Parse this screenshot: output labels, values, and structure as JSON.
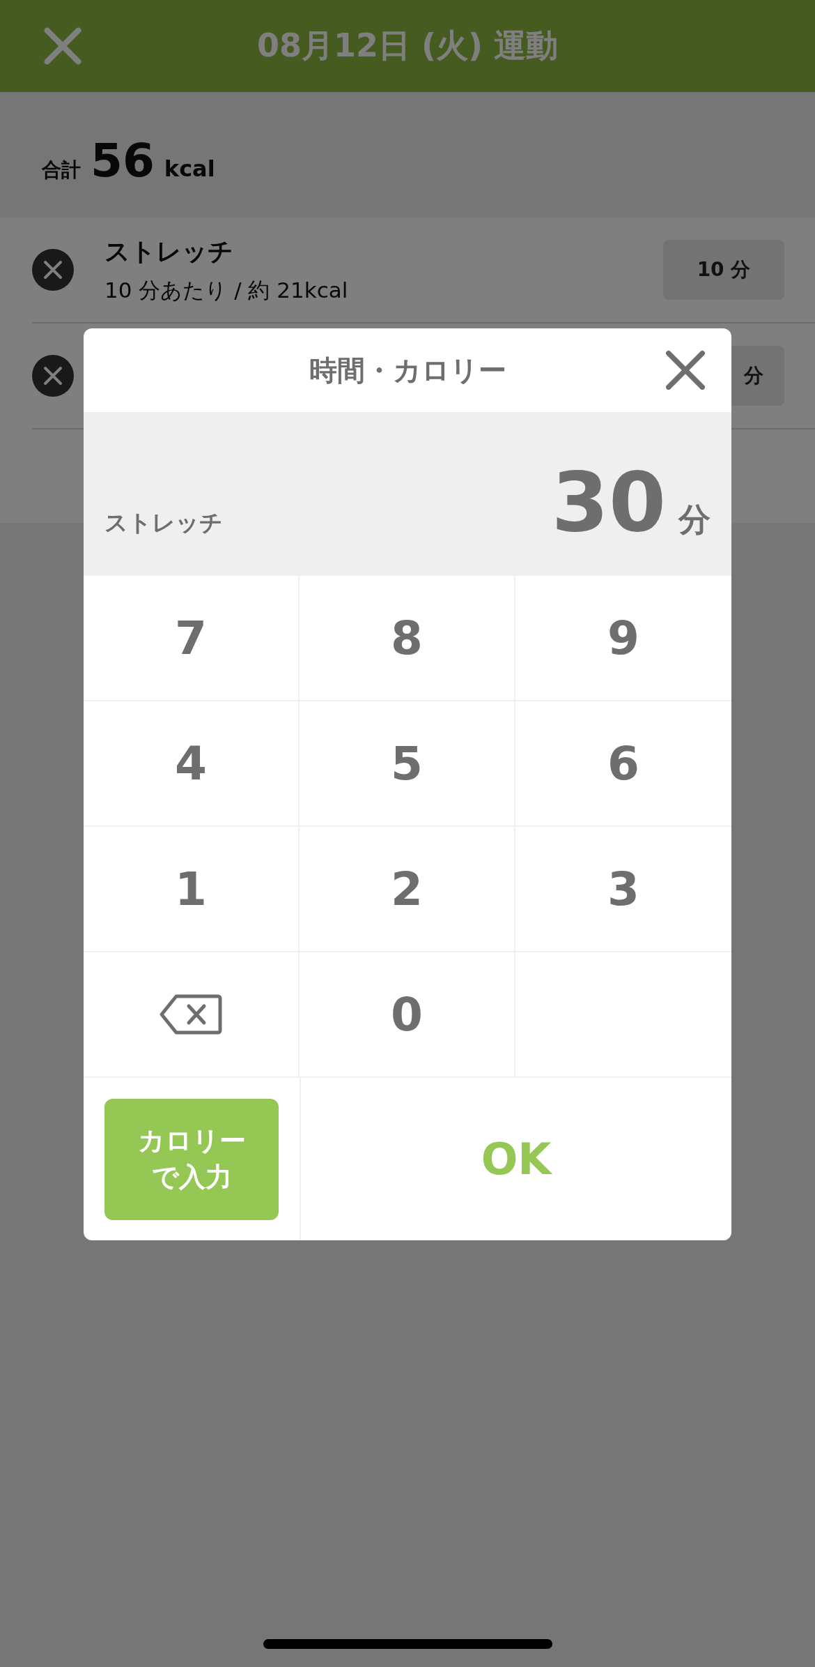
{
  "header": {
    "title": "08月12日 (火) 運動"
  },
  "summary": {
    "label": "合計",
    "value": "56",
    "unit": "kcal"
  },
  "rows": [
    {
      "name": "ストレッチ",
      "detail": "10 分あたり / 約 21kcal",
      "time": "10 分"
    },
    {
      "time": "分"
    }
  ],
  "dialog": {
    "title": "時間・カロリー",
    "item": "ストレッチ",
    "value": "30",
    "unit": "分",
    "keys": [
      {
        "kind": "digit",
        "label": "7"
      },
      {
        "kind": "digit",
        "label": "8"
      },
      {
        "kind": "digit",
        "label": "9"
      },
      {
        "kind": "digit",
        "label": "4"
      },
      {
        "kind": "digit",
        "label": "5"
      },
      {
        "kind": "digit",
        "label": "6"
      },
      {
        "kind": "digit",
        "label": "1"
      },
      {
        "kind": "digit",
        "label": "2"
      },
      {
        "kind": "digit",
        "label": "3"
      },
      {
        "kind": "backspace"
      },
      {
        "kind": "digit",
        "label": "0"
      },
      {
        "kind": "blank"
      }
    ],
    "calorie_button": "カロリーで入力",
    "ok_button": "OK"
  }
}
